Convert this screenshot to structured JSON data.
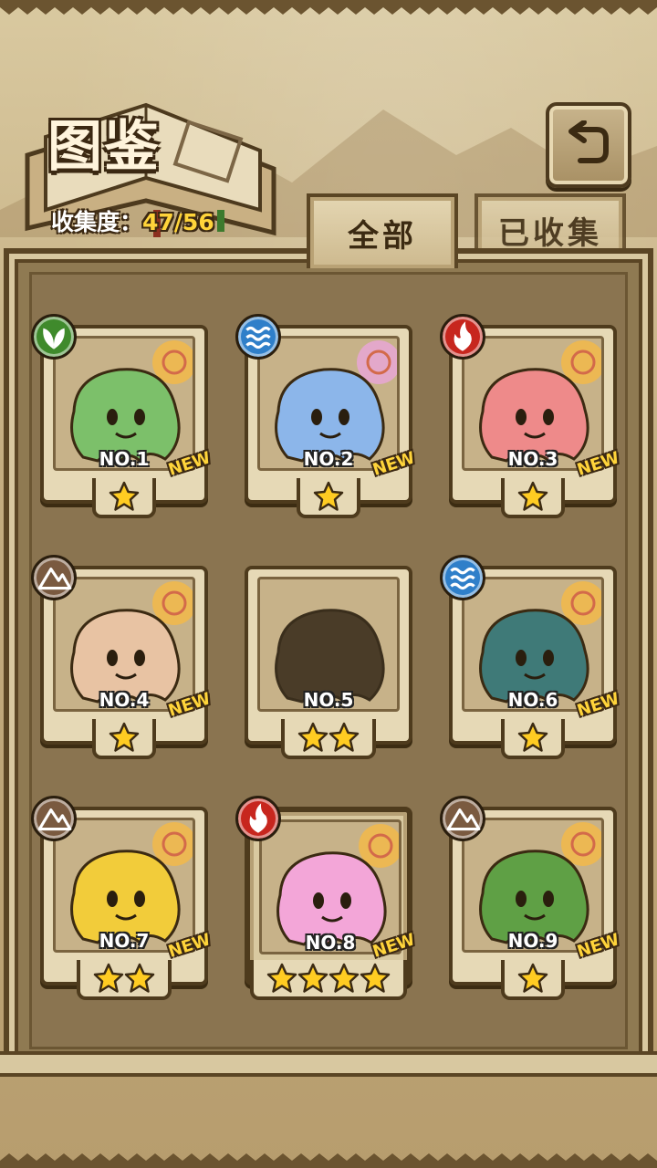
{
  "header": {
    "title": "图鉴",
    "collect_label": "收集度：",
    "collect_value": "47/56"
  },
  "tabs": [
    {
      "label": "全部",
      "active": true
    },
    {
      "label": "已收集",
      "active": false
    }
  ],
  "back_icon": "back-arrow-icon",
  "colors": {
    "grass": "#3f8a2c",
    "water": "#2f7fc9",
    "fire": "#c7261e",
    "earth": "#7a5a40",
    "star": "#ffcc22",
    "new_badge": "#ffd43a",
    "collect_value": "#ffd43a"
  },
  "cards": [
    {
      "no": "NO.1",
      "element": "grass",
      "stars": 1,
      "new": "NEW",
      "color": "#7cc06a",
      "silhouette": false
    },
    {
      "no": "NO.2",
      "element": "water",
      "stars": 1,
      "new": "NEW",
      "color": "#8cb6ea",
      "silhouette": false
    },
    {
      "no": "NO.3",
      "element": "fire",
      "stars": 1,
      "new": "NEW",
      "color": "#ee8a8a",
      "silhouette": false
    },
    {
      "no": "NO.4",
      "element": "earth",
      "stars": 1,
      "new": "NEW",
      "color": "#e8c3a3",
      "silhouette": false
    },
    {
      "no": "NO.5",
      "element": "",
      "stars": 2,
      "new": "",
      "color": "#4a3c28",
      "silhouette": true
    },
    {
      "no": "NO.6",
      "element": "water",
      "stars": 1,
      "new": "NEW",
      "color": "#3f7a78",
      "silhouette": false
    },
    {
      "no": "NO.7",
      "element": "earth",
      "stars": 2,
      "new": "NEW",
      "color": "#f2cc3a",
      "silhouette": false
    },
    {
      "no": "NO.8",
      "element": "fire",
      "stars": 4,
      "new": "NEW",
      "color": "#f3a6d8",
      "silhouette": false
    },
    {
      "no": "NO.9",
      "element": "earth",
      "stars": 1,
      "new": "NEW",
      "color": "#5fa045",
      "silhouette": false
    }
  ]
}
